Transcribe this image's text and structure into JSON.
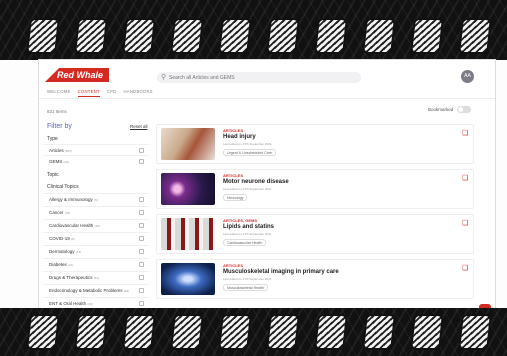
{
  "brand": {
    "logo_text": "Red Whale"
  },
  "search": {
    "placeholder": "Search all Articles and GEMS",
    "icon": "search-icon"
  },
  "user": {
    "initials": "AA"
  },
  "nav": {
    "items": [
      "WELCOME",
      "CONTENT",
      "CPD",
      "HANDBOOKS"
    ],
    "active": "CONTENT"
  },
  "results": {
    "count": "831 Items"
  },
  "bookmarked": {
    "label": "Bookmarked"
  },
  "filter": {
    "title": "Filter by",
    "reset_label": "Reset all",
    "type_label": "Type",
    "types": [
      {
        "label": "Articles",
        "count": "(827)"
      },
      {
        "label": "GEMS",
        "count": "(49)"
      }
    ],
    "topic_label": "Topic",
    "clinical_label": "Clinical Topics",
    "clinical": [
      {
        "label": "Allergy & Immunology",
        "count": "(5)"
      },
      {
        "label": "Cancer",
        "count": "(78)"
      },
      {
        "label": "Cardiovascular Health",
        "count": "(38)"
      },
      {
        "label": "COVID-19",
        "count": "(8)"
      },
      {
        "label": "Dermatology",
        "count": "(44)"
      },
      {
        "label": "Diabetes",
        "count": "(21)"
      },
      {
        "label": "Drugs & Therapeutics",
        "count": "(41)"
      },
      {
        "label": "Endocrinology & Metabolic Problems",
        "count": "(29)"
      },
      {
        "label": "ENT & Oral Health",
        "count": "(20)"
      }
    ]
  },
  "cards": [
    {
      "tag": "ARTICLES",
      "title": "Head injury",
      "date": "Last edited on 27th September 2021",
      "chip": "Urgent & Unscheduled Care"
    },
    {
      "tag": "ARTICLES",
      "title": "Motor neurone disease",
      "date": "Last edited on 27th September 2021",
      "chip": "Neurology"
    },
    {
      "tag": "ARTICLES, GEMS",
      "title": "Lipids and statins",
      "date": "Last edited on 27th September 2021",
      "chip": "Cardiovascular Health"
    },
    {
      "tag": "ARTICLES",
      "title": "Musculoskeletal imaging in primary care",
      "date": "Last edited on 27th September 2021",
      "chip": "Musculoskeletal Health"
    }
  ],
  "colors": {
    "accent": "#d42a22",
    "filter_title": "#5a63c8"
  }
}
